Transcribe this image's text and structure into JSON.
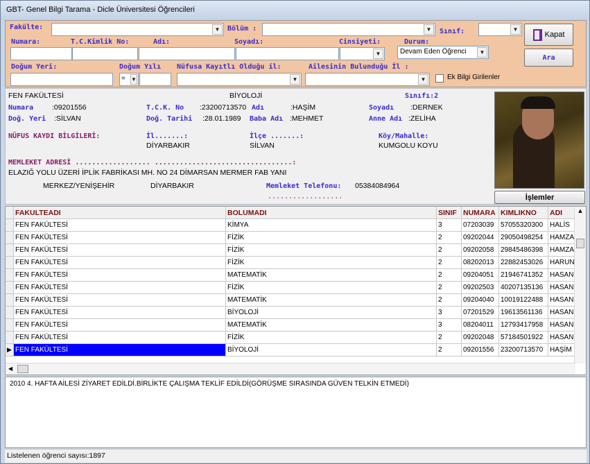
{
  "window": {
    "title": "GBT- Genel Bilgi Tarama - Dicle Üniversitesi Öğrencileri"
  },
  "search": {
    "fakulte_label": "Fakülte:",
    "bolum_label": "Bölüm :",
    "sinif_label": "Sınıf:",
    "numara_label": "Numara:",
    "tc_label": "T.C.Kimlik No:",
    "adi_label": "Adı:",
    "soyadi_label": "Soyadı:",
    "cinsiyeti_label": "Cinsiyeti:",
    "durum_label": "Durum:",
    "durum_value": "Devam Eden Öğrenci",
    "dogum_yeri_label": "Doğum Yeri:",
    "dogum_yili_label": "Doğum Yılı",
    "dogum_yili_op": "=",
    "nufus_label": "Nüfusa Kayıtlı Olduğu il:",
    "aile_label": "Ailesinin Bulunduğu İl :",
    "ek_bilgi_label": "Ek Bilgi Girilenler",
    "kapat_label": "Kapat",
    "ara_label": "Ara"
  },
  "info": {
    "fakulte": "FEN FAKÜLTESİ",
    "bolum": "BİYOLOJİ",
    "sinif": "Sınıfı:2",
    "numara_label": "Numara",
    "numara": ":09201556",
    "tck_label": "T.C.K. No",
    "tck": ":23200713570",
    "adi_label": "Adı",
    "adi": ":HAŞİM",
    "soyadi_label": "Soyadı",
    "soyadi": ":DERNEK",
    "dogyeri_label": "Doğ. Yeri",
    "dogyeri": ":SİLVAN",
    "dogtarihi_label": "Doğ. Tarihi",
    "dogtarihi": ":28.01.1989",
    "baba_label": "Baba Adı",
    "baba": ":MEHMET",
    "anne_label": "Anne Adı",
    "anne": ":ZELİHA",
    "nufus_label": "NÜFUS KAYDI BİLGİLERİ:",
    "il_label": "İl.......:",
    "il": "DİYARBAKIR",
    "ilce_label": "İlçe .......:",
    "ilce": "SİLVAN",
    "koy_label": "Köy/Mahalle:",
    "koy": "KUMGOLU KOYU",
    "memleket_label": "MEMLEKET ADRESİ  .................. .................................:",
    "adres": "ELAZIĞ YOLU ÜZERİ İPLİK FABRİKASI MH. NO 24 DİMARSAN MERMER FAB YANI",
    "adres_ilce": "MERKEZ/YENİŞEHİR",
    "adres_il": "DİYARBAKIR",
    "tel_label": "Memleket Telefonu:",
    "tel": "05384084964",
    "dots": "..................",
    "islemler_label": "İşlemler"
  },
  "grid": {
    "columns": [
      "FAKULTEADI",
      "BOLUMADI",
      "SINIF",
      "NUMARA",
      "KIMLIKNO",
      "ADI"
    ],
    "rows": [
      [
        "FEN FAKÜLTESİ",
        "KİMYA",
        "3",
        "07203039",
        "57055320300",
        "HALİS"
      ],
      [
        "FEN FAKÜLTESİ",
        "FİZİK",
        "2",
        "09202044",
        "29050498254",
        "HAMZA"
      ],
      [
        "FEN FAKÜLTESİ",
        "FİZİK",
        "2",
        "09202058",
        "29845486398",
        "HAMZA"
      ],
      [
        "FEN FAKÜLTESİ",
        "FİZİK",
        "2",
        "08202013",
        "22882453026",
        "HARUN"
      ],
      [
        "FEN FAKÜLTESİ",
        "MATEMATİK",
        "2",
        "09204051",
        "21946741352",
        "HASAN"
      ],
      [
        "FEN FAKÜLTESİ",
        "FİZİK",
        "2",
        "09202503",
        "40207135136",
        "HASAN"
      ],
      [
        "FEN FAKÜLTESİ",
        "MATEMATİK",
        "2",
        "09204040",
        "10019122488",
        "HASAN"
      ],
      [
        "FEN FAKÜLTESİ",
        "BİYOLOJİ",
        "3",
        "07201529",
        "19613561136",
        "HASAN"
      ],
      [
        "FEN FAKÜLTESİ",
        "MATEMATİK",
        "3",
        "08204011",
        "12793417958",
        "HASAN"
      ],
      [
        "FEN FAKÜLTESİ",
        "FİZİK",
        "2",
        "09202048",
        "57184501922",
        "HASAN"
      ],
      [
        "FEN FAKÜLTESİ",
        "BİYOLOJİ",
        "2",
        "09201556",
        "23200713570",
        "HAŞİM"
      ]
    ],
    "selected_row": 10
  },
  "notes": {
    "text": "2010 4. HAFTA AİLESİ ZİYARET EDİLDİ.BİRLİKTE ÇALIŞMA TEKLİF EDİLDİ(GÖRÜŞME SIRASINDA GÜVEN TELKİN ETMEDİ)"
  },
  "status": {
    "text": "Listelenen öğrenci sayısı:1897"
  },
  "colors": {
    "search_bg": "#f2c6a2",
    "label_blue": "#3a2ad0",
    "label_maroon": "#8a1a6a",
    "header_red": "#7a1010",
    "selection": "#0000ff"
  },
  "icons": {
    "kapat": "door-exit-icon",
    "row_pointer": "row-pointer-icon"
  }
}
